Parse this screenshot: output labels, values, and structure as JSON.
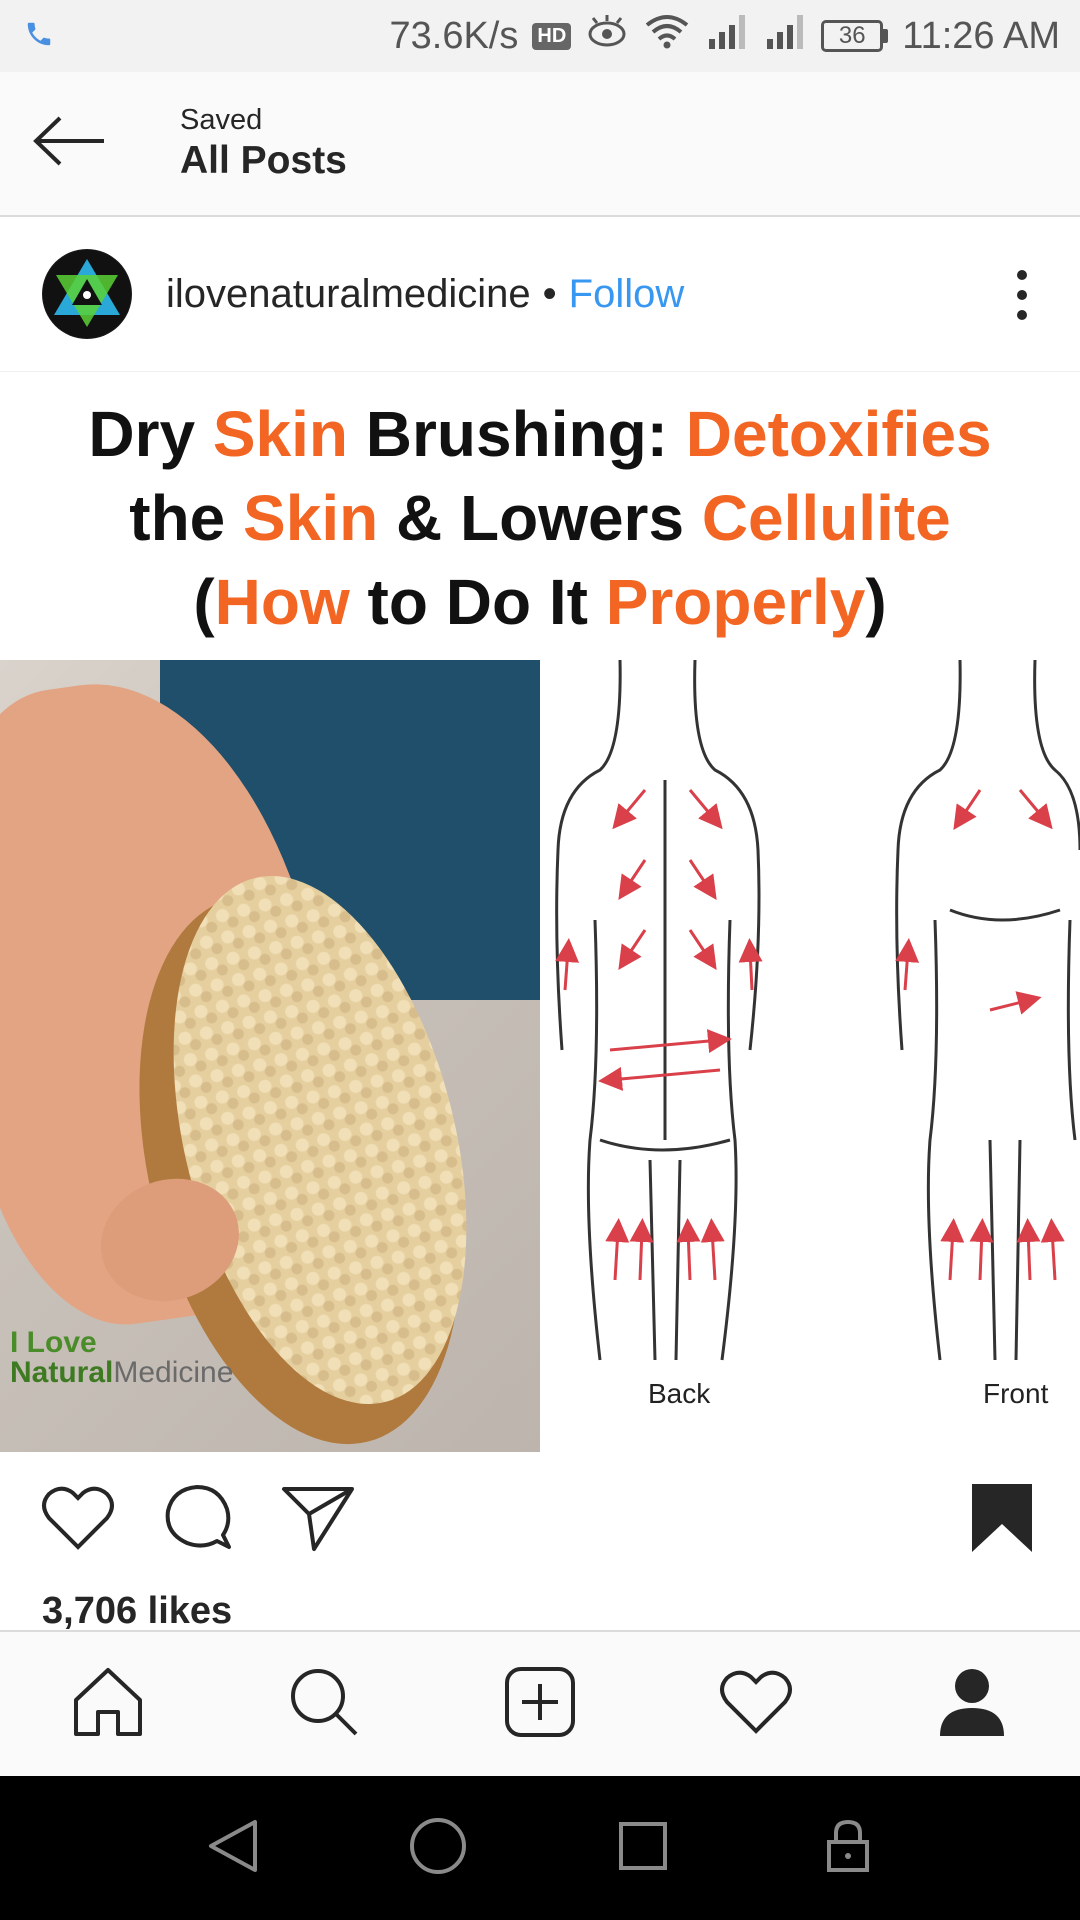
{
  "status_bar": {
    "speed": "73.6K/s",
    "hd": "HD",
    "battery": "36",
    "time": "11:26 AM"
  },
  "header": {
    "subtitle": "Saved",
    "title": "All Posts"
  },
  "post": {
    "username": "ilovenaturalmedicine",
    "separator": "•",
    "follow_label": "Follow",
    "image": {
      "headline": {
        "l1a": "Dry ",
        "l1b": "Skin",
        "l1c": " Brushing: ",
        "l1d": "Detoxifies",
        "l2a": "the ",
        "l2b": "Skin",
        "l2c": " & Lowers ",
        "l2d": "Cellulite",
        "l3a": "(",
        "l3b": "How",
        "l3c": " to Do It ",
        "l3d": "Properly",
        "l3e": ")"
      },
      "logo_line1": "I Love",
      "logo_line2a": "Natural",
      "logo_line2b": "Medicine",
      "label_back": "Back",
      "label_front": "Front"
    },
    "likes": "3,706 likes"
  },
  "icons": {
    "back": "arrow-left-icon",
    "more": "more-vertical-icon",
    "like": "heart-icon",
    "comment": "comment-icon",
    "share": "send-icon",
    "save": "bookmark-icon"
  },
  "colors": {
    "follow": "#3897f0",
    "headline_accent": "#f26522"
  }
}
